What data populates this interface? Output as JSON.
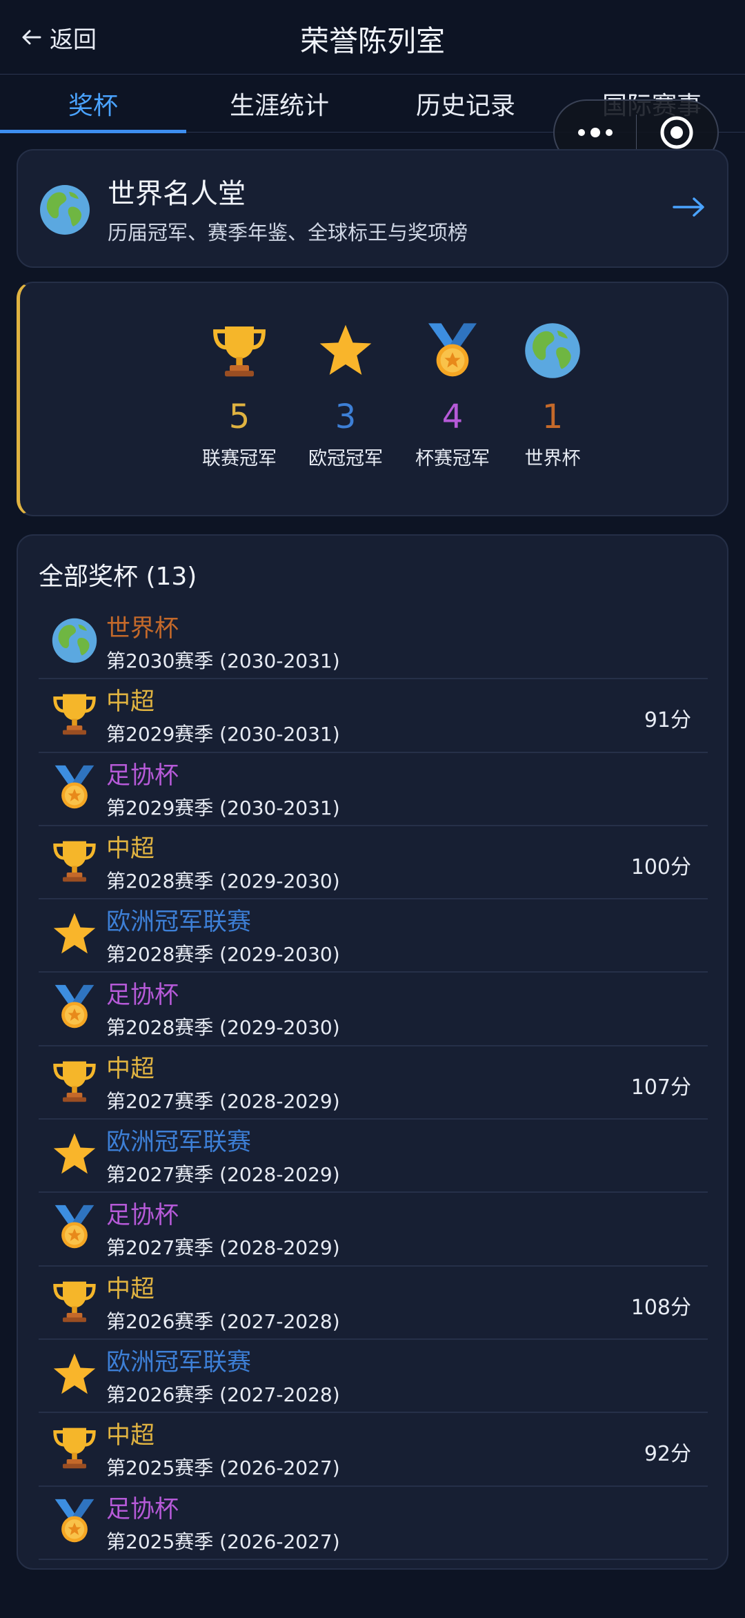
{
  "header": {
    "back_label": "返回",
    "title": "荣誉陈列室"
  },
  "tabs": [
    {
      "label": "奖杯",
      "active": true
    },
    {
      "label": "生涯统计",
      "active": false
    },
    {
      "label": "历史记录",
      "active": false
    },
    {
      "label": "国际赛事",
      "active": false
    }
  ],
  "hall_of_fame": {
    "title": "世界名人堂",
    "subtitle": "历届冠军、赛季年鉴、全球标王与奖项榜"
  },
  "summary": [
    {
      "icon": "trophy-icon",
      "count": "5",
      "label": "联赛冠军",
      "color": "#e0b341"
    },
    {
      "icon": "star-icon",
      "count": "3",
      "label": "欧冠冠军",
      "color": "#3d7fd6"
    },
    {
      "icon": "medal-icon",
      "count": "4",
      "label": "杯赛冠军",
      "color": "#b65ad8"
    },
    {
      "icon": "globe-icon",
      "count": "1",
      "label": "世界杯",
      "color": "#c4692a"
    }
  ],
  "trophy_list": {
    "title": "全部奖杯 (13)",
    "items": [
      {
        "icon": "globe-icon",
        "name": "世界杯",
        "season": "第2030赛季 (2030-2031)",
        "points": "",
        "color": "#c4692a"
      },
      {
        "icon": "trophy-icon",
        "name": "中超",
        "season": "第2029赛季 (2030-2031)",
        "points": "91分",
        "color": "#e0b341"
      },
      {
        "icon": "medal-icon",
        "name": "足协杯",
        "season": "第2029赛季 (2030-2031)",
        "points": "",
        "color": "#b65ad8"
      },
      {
        "icon": "trophy-icon",
        "name": "中超",
        "season": "第2028赛季 (2029-2030)",
        "points": "100分",
        "color": "#e0b341"
      },
      {
        "icon": "star-icon",
        "name": "欧洲冠军联赛",
        "season": "第2028赛季 (2029-2030)",
        "points": "",
        "color": "#3d7fd6"
      },
      {
        "icon": "medal-icon",
        "name": "足协杯",
        "season": "第2028赛季 (2029-2030)",
        "points": "",
        "color": "#b65ad8"
      },
      {
        "icon": "trophy-icon",
        "name": "中超",
        "season": "第2027赛季 (2028-2029)",
        "points": "107分",
        "color": "#e0b341"
      },
      {
        "icon": "star-icon",
        "name": "欧洲冠军联赛",
        "season": "第2027赛季 (2028-2029)",
        "points": "",
        "color": "#3d7fd6"
      },
      {
        "icon": "medal-icon",
        "name": "足协杯",
        "season": "第2027赛季 (2028-2029)",
        "points": "",
        "color": "#b65ad8"
      },
      {
        "icon": "trophy-icon",
        "name": "中超",
        "season": "第2026赛季 (2027-2028)",
        "points": "108分",
        "color": "#e0b341"
      },
      {
        "icon": "star-icon",
        "name": "欧洲冠军联赛",
        "season": "第2026赛季 (2027-2028)",
        "points": "",
        "color": "#3d7fd6"
      },
      {
        "icon": "trophy-icon",
        "name": "中超",
        "season": "第2025赛季 (2026-2027)",
        "points": "92分",
        "color": "#e0b341"
      },
      {
        "icon": "medal-icon",
        "name": "足协杯",
        "season": "第2025赛季 (2026-2027)",
        "points": "",
        "color": "#b65ad8"
      }
    ]
  }
}
